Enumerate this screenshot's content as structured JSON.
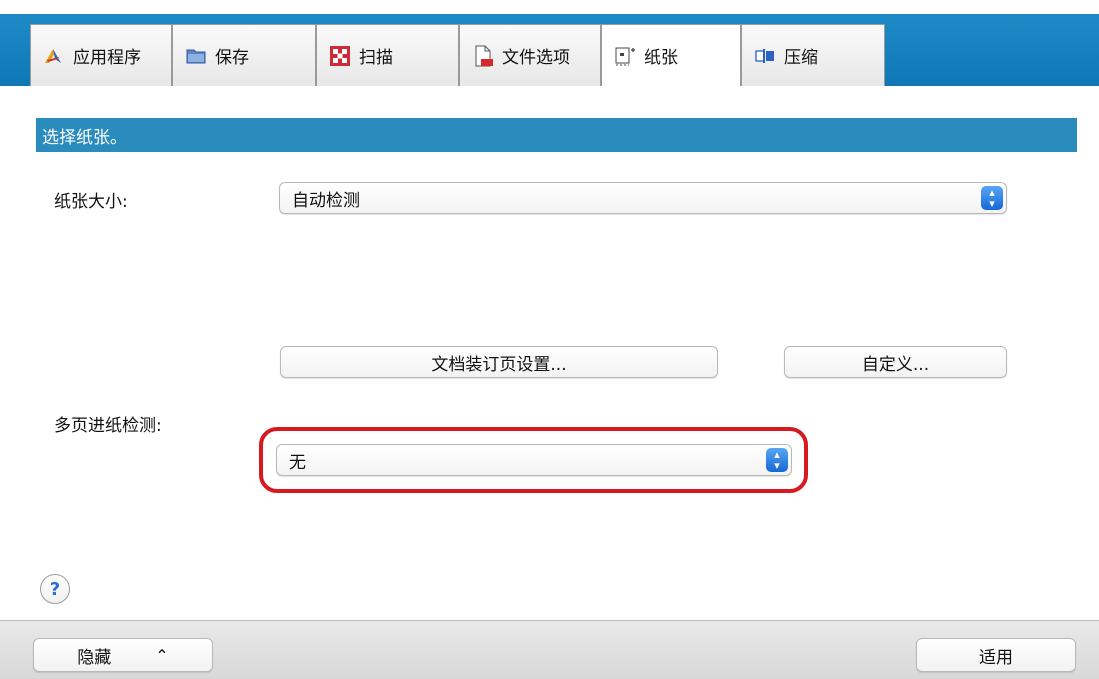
{
  "tabs": [
    {
      "label": "应用程序",
      "icon": "application-icon"
    },
    {
      "label": "保存",
      "icon": "folder-icon"
    },
    {
      "label": "扫描",
      "icon": "scan-icon"
    },
    {
      "label": "文件选项",
      "icon": "file-option-icon"
    },
    {
      "label": "纸张",
      "icon": "paper-icon"
    },
    {
      "label": "压缩",
      "icon": "compression-icon"
    }
  ],
  "active_tab": "纸张",
  "section": {
    "header": "选择纸张。"
  },
  "paper_size": {
    "label": "纸张大小:",
    "value": "自动检测"
  },
  "buttons": {
    "binding_settings": "文档装订页设置...",
    "custom": "自定义..."
  },
  "multifeed": {
    "label": "多页进纸检测:",
    "value": "无"
  },
  "help": {
    "symbol": "?"
  },
  "footer": {
    "hide_label": "隐藏",
    "hide_chevron": "⌃",
    "apply_label": "适用"
  },
  "colors": {
    "tabbar": "#1e8bc7",
    "section_header": "#2a8bbd",
    "highlight": "#d71920",
    "stepper": "#1767d6"
  }
}
